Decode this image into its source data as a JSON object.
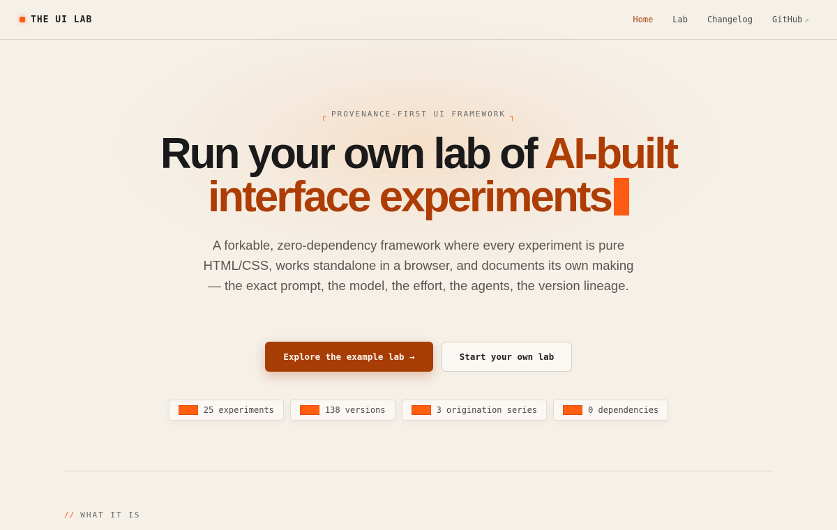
{
  "brand": {
    "name": "THE UI LAB"
  },
  "nav": {
    "items": [
      {
        "label": "Home"
      },
      {
        "label": "Lab"
      },
      {
        "label": "Changelog"
      },
      {
        "label": "GitHub"
      }
    ],
    "external_glyph": "↗"
  },
  "hero": {
    "eyebrow": "PROVENANCE-FIRST UI FRAMEWORK",
    "eyebrow_bracket_left": "┌",
    "eyebrow_bracket_right": "┐",
    "title_plain": "Run your own lab of ",
    "title_accent_1": "AI-built",
    "title_accent_2": "interface experiments",
    "subtitle": "A forkable, zero-dependency framework where every experiment is pure HTML/CSS, works standalone in a browser, and documents its own making — the exact prompt, the model, the effort, the agents, the version lineage."
  },
  "cta": {
    "primary": "Explore the example lab →",
    "secondary": "Start your own lab"
  },
  "stats": [
    {
      "label": "25 experiments"
    },
    {
      "label": "138 versions"
    },
    {
      "label": "3 origination series"
    },
    {
      "label": "0 dependencies"
    }
  ],
  "section": {
    "prefix": "//",
    "label": "WHAT IT IS"
  },
  "colors": {
    "background": "#f5f0e8",
    "accent": "#ff5a14",
    "accent_dark": "#a83c05",
    "text": "#1a1a1a"
  }
}
